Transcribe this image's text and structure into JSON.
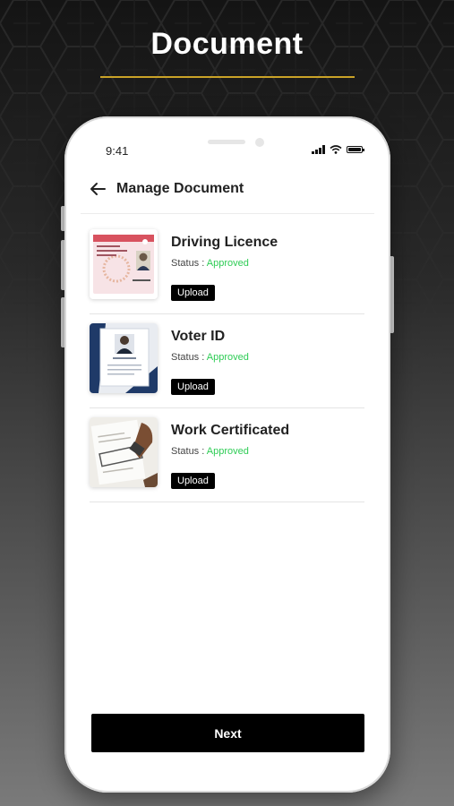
{
  "hero": {
    "title": "Document"
  },
  "status_bar": {
    "time": "9:41"
  },
  "header": {
    "title": "Manage Document",
    "back_icon": "arrow-left-icon"
  },
  "documents": [
    {
      "name": "Driving Licence",
      "status_label": "Status :",
      "status_value": "Approved",
      "upload_label": "Upload",
      "thumb": "driving-licence-thumbnail"
    },
    {
      "name": "Voter ID",
      "status_label": "Status :",
      "status_value": "Approved",
      "upload_label": "Upload",
      "thumb": "voter-id-thumbnail"
    },
    {
      "name": "Work Certificated",
      "status_label": "Status :",
      "status_value": "Approved",
      "upload_label": "Upload",
      "thumb": "work-certificate-thumbnail"
    }
  ],
  "footer": {
    "next_label": "Next"
  },
  "colors": {
    "accent_line": "#c9a227",
    "approved": "#2ecc55",
    "button": "#000000"
  }
}
